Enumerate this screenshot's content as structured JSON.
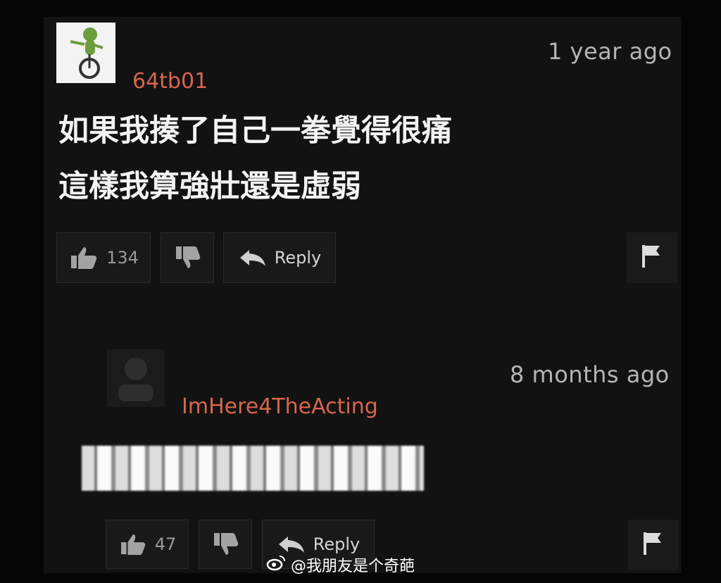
{
  "comments": [
    {
      "timestamp": "1 year ago",
      "username": "64tb01",
      "text_lines": [
        "如果我揍了自己一拳覺得很痛",
        "這樣我算強壯還是虛弱"
      ],
      "likes": "134",
      "reply_label": "Reply"
    },
    {
      "timestamp": "8 months ago",
      "username": "ImHere4TheActing",
      "likes": "47",
      "reply_label": "Reply"
    }
  ],
  "watermark": "@我朋友是个奇葩",
  "colors": {
    "background": "#050505",
    "panel": "#121212",
    "username": "#d8664d",
    "text": "#f3f3f3"
  },
  "icons": [
    "frog-unicycle-avatar",
    "default-user-icon",
    "thumbs-up-icon",
    "thumbs-down-icon",
    "reply-arrow-icon",
    "flag-icon",
    "weibo-icon"
  ]
}
